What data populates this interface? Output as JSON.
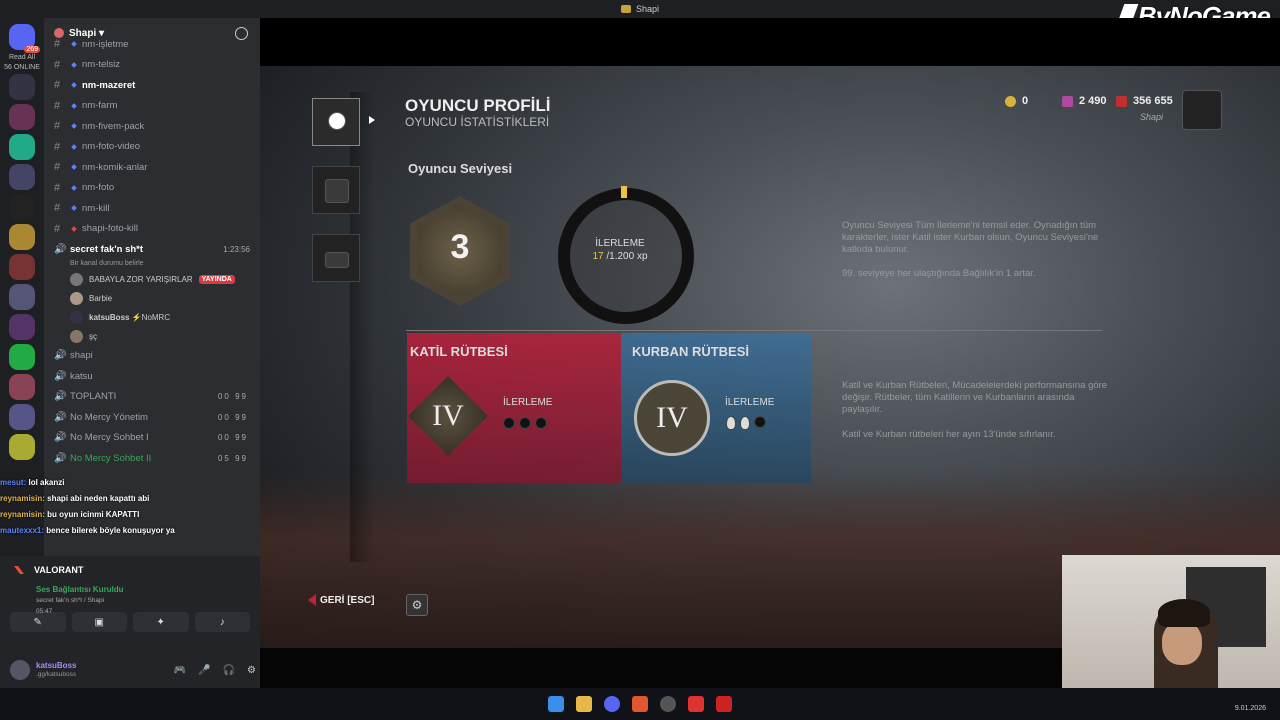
{
  "window": {
    "title": "Shapi",
    "brand": "ByNoGame"
  },
  "servers": {
    "badge": "269",
    "read_all": "Read All",
    "online": "56 ONLINE",
    "items": [
      "s1",
      "s2",
      "s3",
      "s4",
      "s5",
      "s6",
      "s7",
      "s8",
      "s9",
      "s10",
      "s11",
      "s12",
      "s13",
      "s14",
      "s15"
    ]
  },
  "channels": {
    "server_name": "Shapi",
    "text": [
      {
        "name": "nm-işletme"
      },
      {
        "name": "nm-telsiz"
      },
      {
        "name": "nm-mazeret"
      },
      {
        "name": "nm-farm"
      },
      {
        "name": "nm-fivem-pack"
      },
      {
        "name": "nm-foto-video"
      },
      {
        "name": "nm-komik-anlar"
      },
      {
        "name": "nm-foto"
      },
      {
        "name": "nm-kill"
      },
      {
        "name": "shapi-foto-kill"
      }
    ],
    "voice_active": {
      "name": "secret fak'n sh*t",
      "time": "1:23:56",
      "status": "Bir kanal durumu belirle"
    },
    "voice_users": [
      {
        "name": "BABAYLA ZOR YARIŞIRLAR",
        "live": "YAYINDA"
      },
      {
        "name": "Barbie"
      },
      {
        "name": "katsuBoss",
        "tag": "⚡NoMRC"
      },
      {
        "name": "şç"
      }
    ],
    "voice_rooms": [
      {
        "name": "shapi",
        "count": ""
      },
      {
        "name": "katsu",
        "count": ""
      },
      {
        "name": "TOPLANTI",
        "count": "00 99"
      },
      {
        "name": "No Mercy Yönetim",
        "count": "00 99"
      },
      {
        "name": "No Mercy Sohbet I",
        "count": "00 99"
      },
      {
        "name": "No Mercy Sohbet II",
        "count": "05 99"
      }
    ]
  },
  "chat_overlay": [
    {
      "user": "mesut:",
      "text": "lol akanzi"
    },
    {
      "user": "reynamisin:",
      "text": "shapi abi neden kapattı abi"
    },
    {
      "user": "reynamisin:",
      "text": "bu oyun icinmi KAPATTI"
    },
    {
      "user": "mautexxx1:",
      "text": "bence bilerek böyle konuşuyor ya"
    }
  ],
  "voice_panel": {
    "game": "VALORANT",
    "status": "Ses Bağlantısı Kuruldu",
    "channel": "secret fak'n sh*t / Shapi",
    "time": "05:47",
    "user": "katsuBoss",
    "user_sub": ".gg/katsuboss"
  },
  "game": {
    "title": "OYUNCU PROFİLİ",
    "subtitle": "OYUNCU İSTATİSTİKLERİ",
    "level_section": "Oyuncu Seviyesi",
    "level": "3",
    "progress_label": "İLERLEME",
    "progress_current": "17",
    "progress_total": "/1.200 xp",
    "progress_fraction": 0.014,
    "desc1": "Oyuncu Seviyesi Tüm İlerleme'ni temsil eder. Oynadığın tüm karakterler, ister Katil ister Kurban olsun, Oyuncu Seviyesi'ne katkıda bulunur.",
    "desc2": "99. seviyeye her ulaştığında Bağlılık'in 1 artar.",
    "killer_rank": "KATİL RÜTBESİ",
    "survivor_rank": "KURBAN RÜTBESİ",
    "rank_numeral": "IV",
    "rank_progress": "İLERLEME",
    "desc3": "Katil ve Kurban Rütbeleri, Mücadelelerdeki performansına göre değişir. Rütbeler, tüm Katillerin ve Kurbanların arasında paylaşılır.",
    "desc4": "Katil ve Kurban rütbeleri her ayın 13'ünde sıfırlanır.",
    "currency1": "0",
    "currency2": "2 490",
    "currency3": "356 655",
    "player": "Shapi",
    "back": "GERİ [ESC]"
  },
  "taskbar": {
    "date": "9.01.2026"
  },
  "colors": {
    "killer": "#b3223c",
    "survivor": "#3b6f9a",
    "accent": "#f0c43a"
  }
}
